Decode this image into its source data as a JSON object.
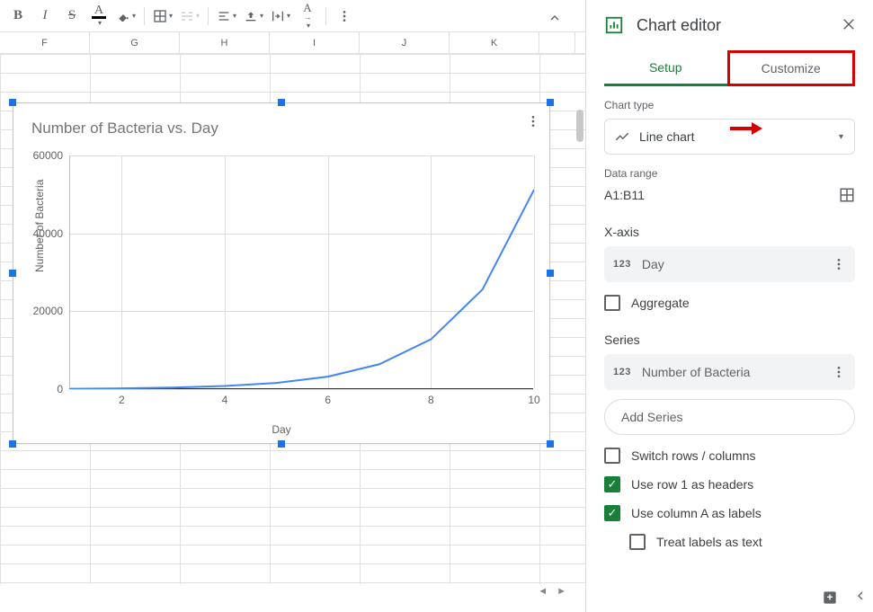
{
  "toolbar": {
    "bold": "B",
    "italic": "I"
  },
  "columns": [
    "F",
    "G",
    "H",
    "I",
    "J",
    "K"
  ],
  "chart_data": {
    "type": "line",
    "title": "Number of Bacteria vs. Day",
    "xlabel": "Day",
    "ylabel": "Number of Bacteria",
    "xlim": [
      1,
      10
    ],
    "ylim": [
      0,
      60000
    ],
    "x": [
      1,
      2,
      3,
      4,
      5,
      6,
      7,
      8,
      9,
      10
    ],
    "values": [
      100,
      200,
      400,
      800,
      1600,
      3200,
      6400,
      12800,
      25600,
      51200
    ],
    "xticks": [
      2,
      4,
      6,
      8,
      10
    ],
    "yticks": [
      0,
      20000,
      40000,
      60000
    ]
  },
  "editor": {
    "title": "Chart editor",
    "tab_setup": "Setup",
    "tab_customize": "Customize",
    "chart_type_lbl": "Chart type",
    "chart_type_val": "Line chart",
    "data_range_lbl": "Data range",
    "data_range_val": "A1:B11",
    "xaxis_lbl": "X-axis",
    "xaxis_val": "Day",
    "aggregate": "Aggregate",
    "series_lbl": "Series",
    "series_val": "Number of Bacteria",
    "add_series": "Add Series",
    "switch": "Switch rows / columns",
    "use_row1": "Use row 1 as headers",
    "use_colA": "Use column A as labels",
    "treat_labels": "Treat labels as text"
  }
}
